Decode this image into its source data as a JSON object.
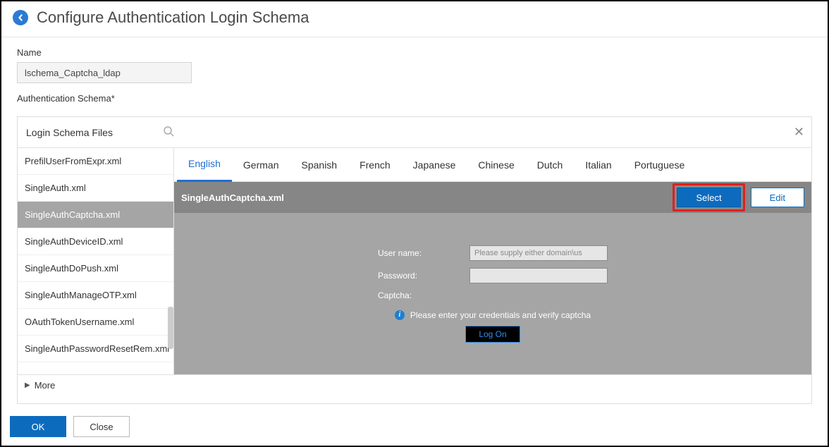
{
  "header": {
    "title": "Configure Authentication Login Schema"
  },
  "form": {
    "name_label": "Name",
    "name_value": "lschema_Captcha_ldap",
    "auth_label": "Authentication Schema*"
  },
  "panel": {
    "title": "Login Schema Files",
    "more_label": "More"
  },
  "sidebar": {
    "items": [
      {
        "label": "PrefilUserFromExpr.xml"
      },
      {
        "label": "SingleAuth.xml"
      },
      {
        "label": "SingleAuthCaptcha.xml"
      },
      {
        "label": "SingleAuthDeviceID.xml"
      },
      {
        "label": "SingleAuthDoPush.xml"
      },
      {
        "label": "SingleAuthManageOTP.xml"
      },
      {
        "label": "OAuthTokenUsername.xml"
      },
      {
        "label": "SingleAuthPasswordResetRem.xml"
      }
    ],
    "selected_index": 2
  },
  "tabs": {
    "items": [
      "English",
      "German",
      "Spanish",
      "French",
      "Japanese",
      "Chinese",
      "Dutch",
      "Italian",
      "Portuguese"
    ],
    "active_index": 0
  },
  "filebar": {
    "filename": "SingleAuthCaptcha.xml",
    "select_label": "Select",
    "edit_label": "Edit"
  },
  "preview_form": {
    "username_label": "User name:",
    "username_placeholder": "Please supply either domain\\us",
    "password_label": "Password:",
    "captcha_label": "Captcha:",
    "info_text": "Please enter your credentials and verify captcha",
    "logon_label": "Log On"
  },
  "footer": {
    "ok_label": "OK",
    "close_label": "Close"
  }
}
